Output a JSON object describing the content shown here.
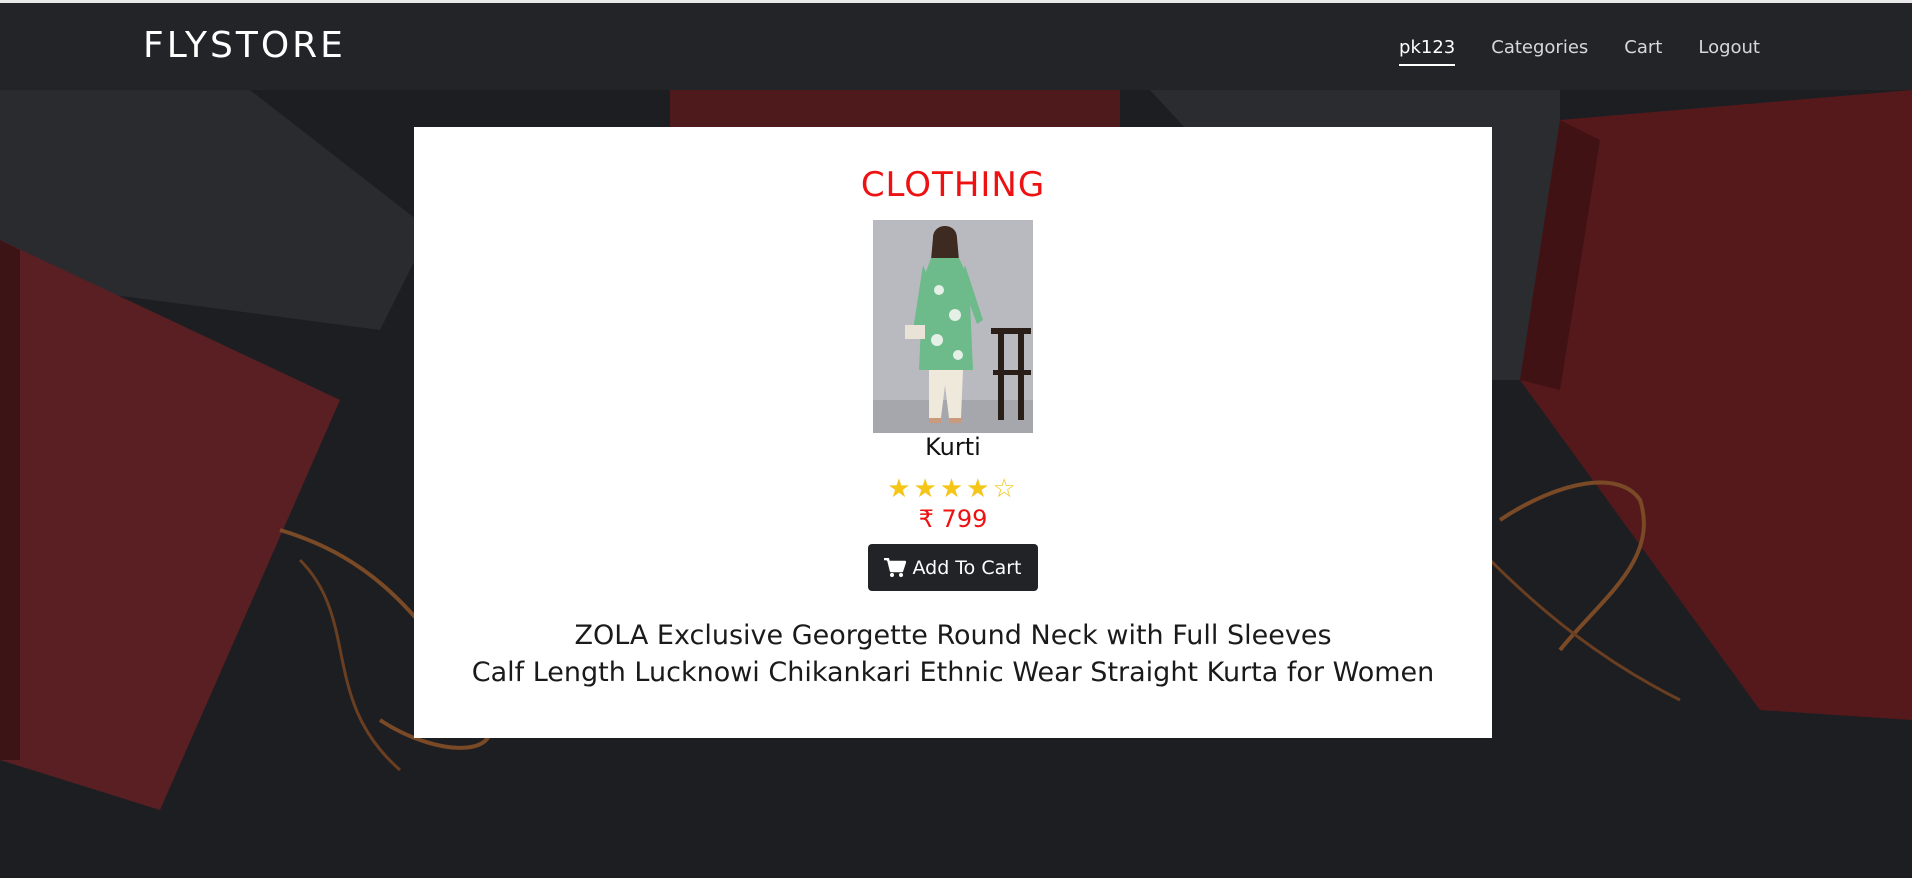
{
  "navbar": {
    "brand": "FLYSTORE",
    "links": [
      {
        "label": "pk123",
        "active": true
      },
      {
        "label": "Categories",
        "active": false
      },
      {
        "label": "Cart",
        "active": false
      },
      {
        "label": "Logout",
        "active": false
      }
    ]
  },
  "product": {
    "category": "CLOTHING",
    "name": "Kurti",
    "rating": 4,
    "rating_max": 5,
    "currency_symbol": "₹",
    "price": "799",
    "add_to_cart_label": "Add To Cart",
    "cart_icon": "shopping-cart-icon",
    "description_line1": "ZOLA Exclusive Georgette Round Neck with Full Sleeves",
    "description_line2": "Calf Length Lucknowi Chikankari Ethnic Wear Straight Kurta for Women"
  },
  "colors": {
    "accent_red": "#ee1111",
    "star": "#f5c518",
    "navbar": "#222428",
    "button": "#212327"
  }
}
